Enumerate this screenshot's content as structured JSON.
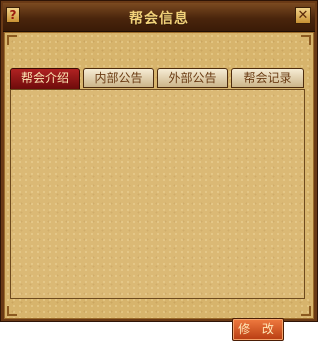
{
  "window": {
    "title": "帮会信息",
    "help_label": "?",
    "close_label": "✕"
  },
  "tabs": [
    {
      "label": "帮会介绍",
      "active": true
    },
    {
      "label": "内部公告",
      "active": false
    },
    {
      "label": "外部公告",
      "active": false
    },
    {
      "label": "帮会记录",
      "active": false
    }
  ],
  "content": {
    "text": ""
  },
  "buttons": {
    "modify_label": "修 改"
  }
}
